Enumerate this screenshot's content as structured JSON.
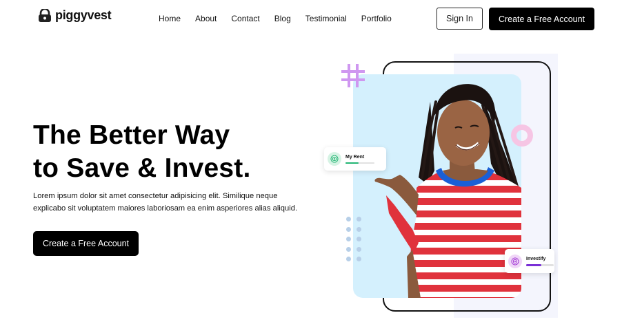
{
  "brand": {
    "name": "piggyvest"
  },
  "nav": {
    "links": [
      "Home",
      "About",
      "Contact",
      "Blog",
      "Testimonial",
      "Portfolio"
    ],
    "sign_in": "Sign In",
    "create_account": "Create a Free Account"
  },
  "hero": {
    "title_line1": "The Better Way",
    "title_line2": "to Save & Invest.",
    "description": "Lorem ipsum dolor sit amet consectetur adipisicing elit. Similique neque explicabo sit voluptatem maiores laboriosam ea enim asperiores alias aliquid.",
    "cta": "Create a Free Account"
  },
  "cards": {
    "rent": {
      "label": "My Rent",
      "progress": 0.45,
      "icon": "fingerprint-icon",
      "color": "#22b573"
    },
    "invest": {
      "label": "Investify",
      "progress": 0.55,
      "icon": "fingerprint-icon",
      "color": "#7a2fd6"
    }
  },
  "colors": {
    "accent": "#000000",
    "card_bg": "#d4f0fd",
    "shirt_red": "#e0323c",
    "collar": "#1a5fd6"
  }
}
